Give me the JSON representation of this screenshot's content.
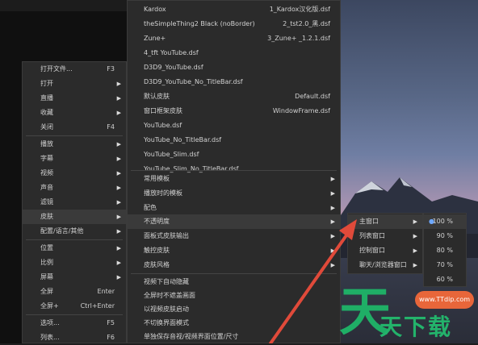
{
  "main_menu": {
    "items": [
      {
        "label": "打开文件...",
        "shortcut": "F3",
        "arrow": false
      },
      {
        "label": "打开",
        "shortcut": "",
        "arrow": true
      },
      {
        "label": "直播",
        "shortcut": "",
        "arrow": true
      },
      {
        "label": "收藏",
        "shortcut": "",
        "arrow": true
      },
      {
        "label": "关闭",
        "shortcut": "F4",
        "arrow": false
      },
      {
        "label": "播放",
        "shortcut": "",
        "arrow": true
      },
      {
        "label": "字幕",
        "shortcut": "",
        "arrow": true
      },
      {
        "label": "视频",
        "shortcut": "",
        "arrow": true
      },
      {
        "label": "声音",
        "shortcut": "",
        "arrow": true
      },
      {
        "label": "滤镜",
        "shortcut": "",
        "arrow": true
      },
      {
        "label": "皮肤",
        "shortcut": "",
        "arrow": true
      },
      {
        "label": "配置/语言/其他",
        "shortcut": "",
        "arrow": true
      },
      {
        "label": "位置",
        "shortcut": "",
        "arrow": true
      },
      {
        "label": "比例",
        "shortcut": "",
        "arrow": true
      },
      {
        "label": "屏幕",
        "shortcut": "",
        "arrow": true
      },
      {
        "label": "全屏",
        "shortcut": "Enter",
        "arrow": false
      },
      {
        "label": "全屏+",
        "shortcut": "Ctrl+Enter",
        "arrow": false
      },
      {
        "label": "选项...",
        "shortcut": "F5",
        "arrow": false
      },
      {
        "label": "列表...",
        "shortcut": "F6",
        "arrow": false
      }
    ]
  },
  "skin_menu": {
    "skins": [
      {
        "label": "Kardox",
        "value": "1_Kardox汉化版.dsf"
      },
      {
        "label": "theSimpleThing2 Black (noBorder)",
        "value": "2_tst2.0_黑.dsf"
      },
      {
        "label": "Zune+",
        "value": "3_Zune+ _1.2.1.dsf"
      },
      {
        "label": "4_tft YouTube.dsf",
        "value": ""
      },
      {
        "label": "D3D9_YouTube.dsf",
        "value": ""
      },
      {
        "label": "D3D9_YouTube_No_TitleBar.dsf",
        "value": ""
      },
      {
        "label": "默认皮肤",
        "value": "Default.dsf"
      },
      {
        "label": "窗口框架皮肤",
        "value": "WindowFrame.dsf"
      },
      {
        "label": "YouTube.dsf",
        "value": ""
      },
      {
        "label": "YouTube_No_TitleBar.dsf",
        "value": ""
      },
      {
        "label": "YouTube_Slim.dsf",
        "value": ""
      },
      {
        "label": "YouTube_Slim_No_TitleBar.dsf",
        "value": ""
      }
    ],
    "options": [
      {
        "label": "常用模板",
        "arrow": true
      },
      {
        "label": "播放时的模板",
        "arrow": true
      },
      {
        "label": "配色",
        "arrow": true
      },
      {
        "label": "不透明度",
        "arrow": true
      },
      {
        "label": "面板式皮肤输出",
        "arrow": true
      },
      {
        "label": "触控皮肤",
        "arrow": true
      },
      {
        "label": "皮肤风格",
        "arrow": true
      }
    ],
    "actions": [
      {
        "label": "视频下自动隐藏"
      },
      {
        "label": "全屏时不遮盖画面"
      },
      {
        "label": "以视频皮肤启动"
      },
      {
        "label": "不切换界面模式"
      },
      {
        "label": "单独保存音视/视频界面位置/尺寸"
      }
    ]
  },
  "opacity_menu": {
    "items": [
      {
        "label": "主窗口",
        "arrow": true
      },
      {
        "label": "列表窗口",
        "arrow": true
      },
      {
        "label": "控制窗口",
        "arrow": true
      },
      {
        "label": "聊天/浏览器窗口",
        "arrow": true
      }
    ]
  },
  "percent_menu": {
    "items": [
      {
        "label": "100 %",
        "checked": true
      },
      {
        "label": "90 %",
        "checked": false
      },
      {
        "label": "80 %",
        "checked": false
      },
      {
        "label": "70 %",
        "checked": false
      },
      {
        "label": "60 %",
        "checked": false
      }
    ]
  },
  "watermark": {
    "url": "www.TTdip.com",
    "big": "天",
    "text": "天下载"
  },
  "colors": {
    "accent": "#6ea8ff",
    "arrow": "#e04a3a",
    "menu_bg": "#2b2b2b",
    "watermark_green": "#23b36b",
    "watermark_orange": "#e8663a"
  }
}
